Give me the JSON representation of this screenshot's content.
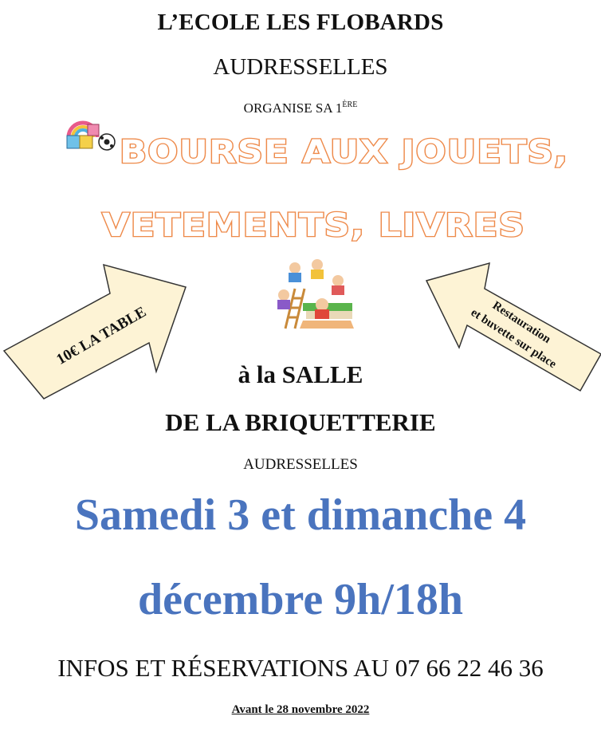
{
  "header": {
    "school": "L’ECOLE LES FLOBARDS",
    "town": "AUDRESSELLES",
    "organise_prefix": "ORGANISE SA 1",
    "organise_sup": "ÈRE"
  },
  "headline": {
    "line1": "BOURSE AUX JOUETS,",
    "line2": "VETEMENTS, LIVRES"
  },
  "left_arrow": {
    "text": "10€ LA TABLE"
  },
  "right_arrow": {
    "line1": "Restauration",
    "line2": "et buvette sur place"
  },
  "venue": {
    "line1": "à la SALLE",
    "line2": "DE LA BRIQUETTERIE",
    "town": "AUDRESSELLES"
  },
  "dates": {
    "line1": "Samedi 3 et dimanche 4",
    "line2": "décembre 9h/18h"
  },
  "contact": {
    "infos": "INFOS ET RÉSERVATIONS AU 07 66 22 46 36",
    "deadline": "Avant le 28 novembre 2022"
  },
  "colors": {
    "headline_outline": "#ee8a4a",
    "date_text": "#4a74be",
    "arrow_fill": "#fdf3d5"
  },
  "icons": [
    "toy-blocks-icon",
    "kids-reading-books-icon"
  ]
}
